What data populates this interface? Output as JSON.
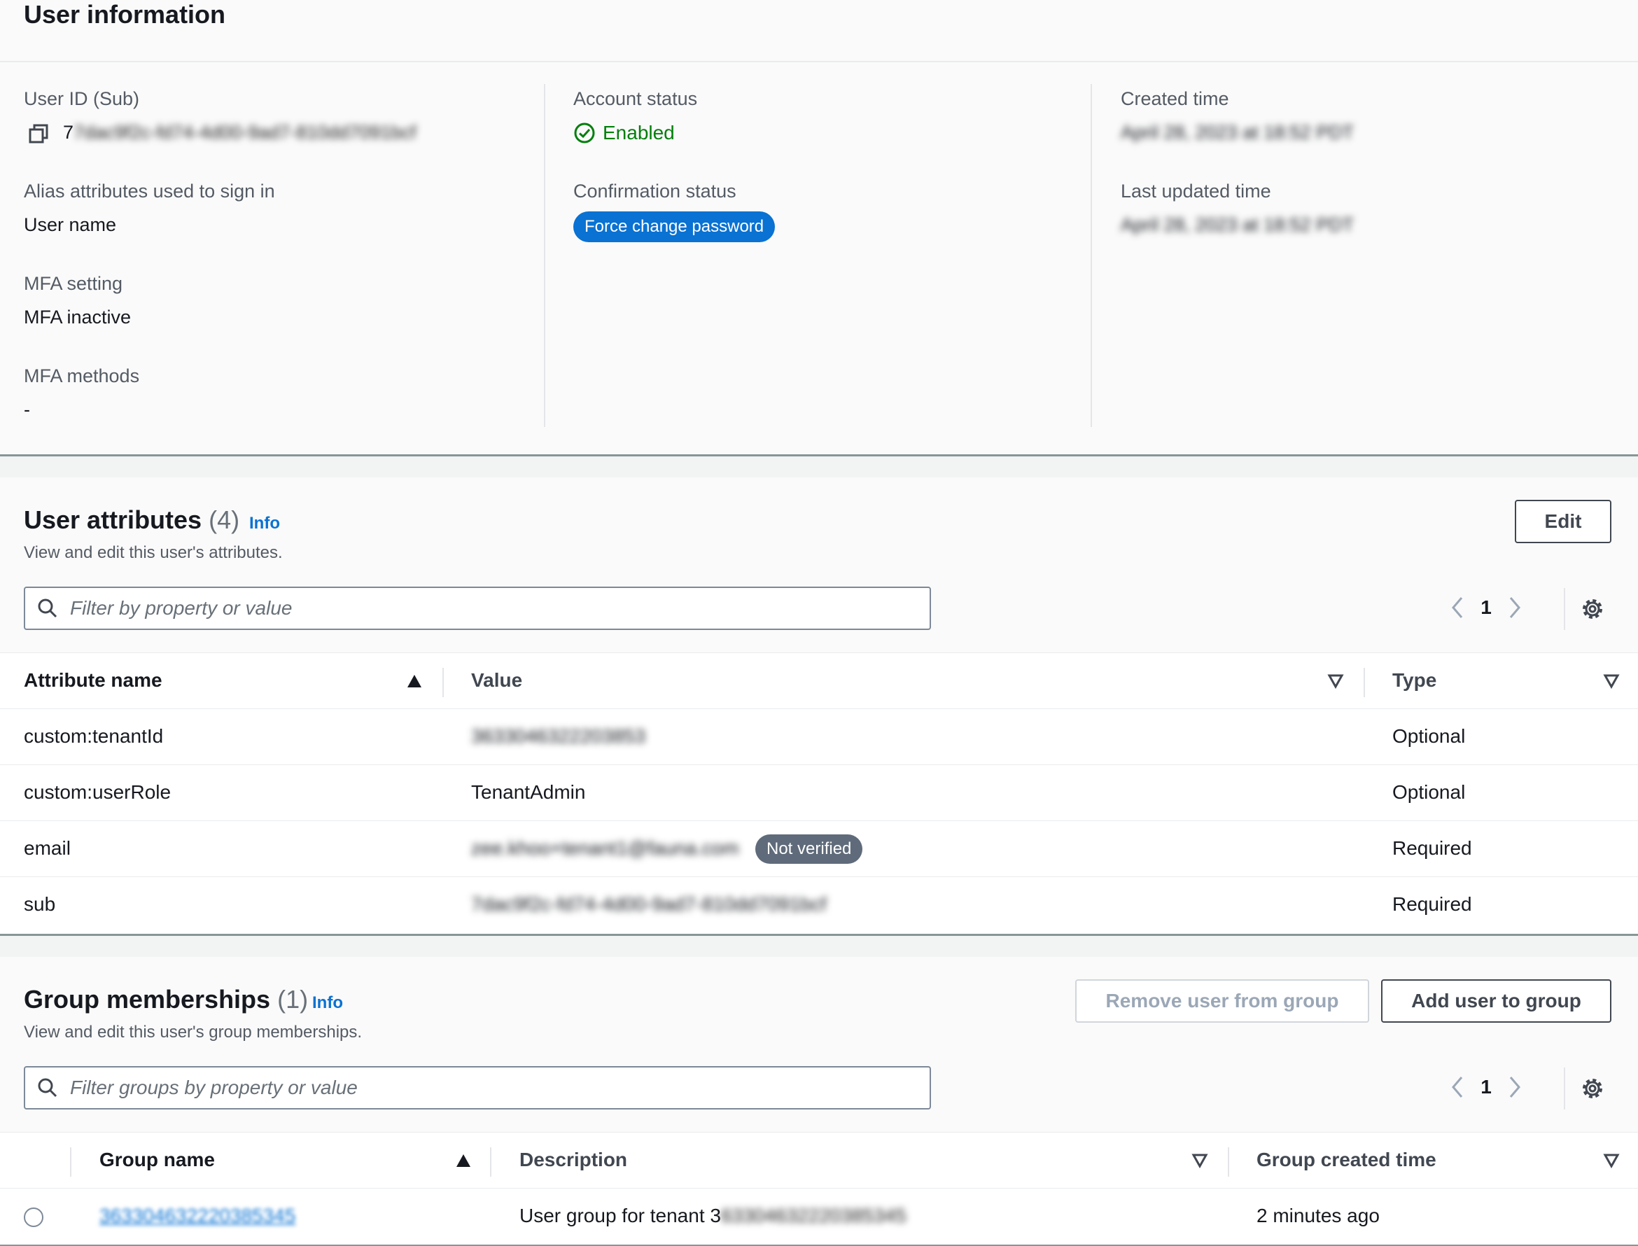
{
  "user_info": {
    "title": "User information",
    "user_id": {
      "label": "User ID (Sub)",
      "value": "7dac9f2c-fd74-4d00-9ad7-810dd7091bcf"
    },
    "alias": {
      "label": "Alias attributes used to sign in",
      "value": "User name"
    },
    "mfa_setting": {
      "label": "MFA setting",
      "value": "MFA inactive"
    },
    "mfa_methods": {
      "label": "MFA methods",
      "value": "-"
    },
    "account_status": {
      "label": "Account status",
      "value": "Enabled"
    },
    "confirmation_status": {
      "label": "Confirmation status",
      "value": "Force change password"
    },
    "created_time": {
      "label": "Created time",
      "value": "April 28, 2023 at 18:52 PDT"
    },
    "last_updated": {
      "label": "Last updated time",
      "value": "April 28, 2023 at 18:52 PDT"
    }
  },
  "attributes": {
    "title": "User attributes",
    "count": "(4)",
    "info": "Info",
    "description": "View and edit this user's attributes.",
    "edit_label": "Edit",
    "filter_placeholder": "Filter by property or value",
    "page": "1",
    "columns": {
      "name": "Attribute name",
      "value": "Value",
      "type": "Type"
    },
    "rows": [
      {
        "name": "custom:tenantId",
        "value": "3633046322203853",
        "type": "Optional"
      },
      {
        "name": "custom:userRole",
        "value": "TenantAdmin",
        "type": "Optional"
      },
      {
        "name": "email",
        "value": "zee.khoo+tenant1@fauna.com",
        "badge": "Not verified",
        "type": "Required"
      },
      {
        "name": "sub",
        "value": "7dac9f2c-fd74-4d00-9ad7-810dd7091bcf",
        "type": "Required"
      }
    ]
  },
  "groups": {
    "title": "Group memberships",
    "count": "(1)",
    "info": "Info",
    "description": "View and edit this user's group memberships.",
    "remove_label": "Remove user from group",
    "add_label": "Add user to group",
    "filter_placeholder": "Filter groups by property or value",
    "page": "1",
    "columns": {
      "name": "Group name",
      "description": "Description",
      "created": "Group created time"
    },
    "rows": [
      {
        "name": "363304632220385345",
        "description_prefix": "User group for tenant 3",
        "description_blur": "63304632220385345",
        "created": "2 minutes ago"
      }
    ]
  }
}
